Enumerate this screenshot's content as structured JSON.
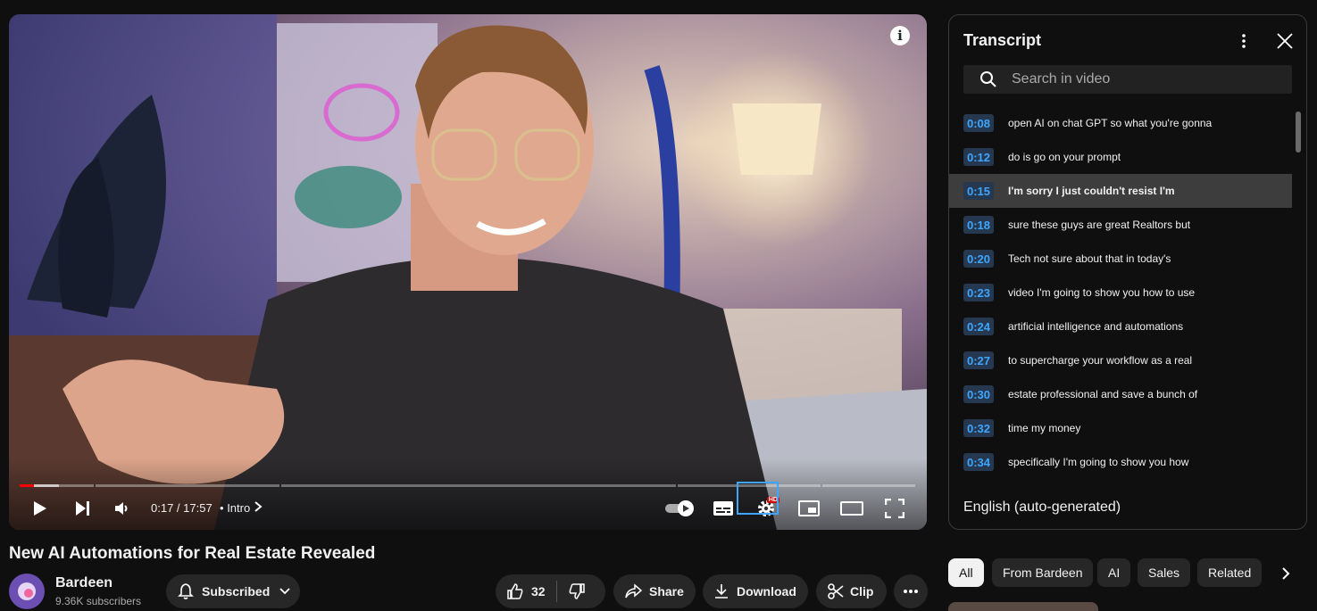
{
  "video": {
    "current_time": "0:17 / 17:57",
    "chapter": "Intro",
    "progress_fraction": 0.016,
    "settings_badge": "HD"
  },
  "title": "New AI Automations for Real Estate Revealed",
  "channel": {
    "name": "Bardeen",
    "subscribers": "9.36K subscribers",
    "subscribe_label": "Subscribed"
  },
  "actions": {
    "like_count": "32",
    "share_label": "Share",
    "download_label": "Download",
    "clip_label": "Clip"
  },
  "transcript": {
    "title": "Transcript",
    "search_placeholder": "Search in video",
    "language": "English (auto-generated)",
    "segments": [
      {
        "time": "0:08",
        "text": "open AI on chat GPT so what you're gonna"
      },
      {
        "time": "0:12",
        "text": "do is go on your prompt"
      },
      {
        "time": "0:15",
        "text": "I'm sorry I just couldn't resist I'm"
      },
      {
        "time": "0:18",
        "text": "sure these guys are great Realtors but"
      },
      {
        "time": "0:20",
        "text": "Tech not sure about that in today's"
      },
      {
        "time": "0:23",
        "text": "video I'm going to show you how to use"
      },
      {
        "time": "0:24",
        "text": "artificial intelligence and automations"
      },
      {
        "time": "0:27",
        "text": "to supercharge your workflow as a real"
      },
      {
        "time": "0:30",
        "text": "estate professional and save a bunch of"
      },
      {
        "time": "0:32",
        "text": "time my money"
      },
      {
        "time": "0:34",
        "text": "specifically I'm going to show you how"
      }
    ]
  },
  "chips": [
    "All",
    "From Bardeen",
    "AI",
    "Sales",
    "Related"
  ],
  "colors": {
    "accent_blue": "#3ea6ff",
    "progress_red": "#ff0000",
    "background": "#0f0f0f"
  }
}
